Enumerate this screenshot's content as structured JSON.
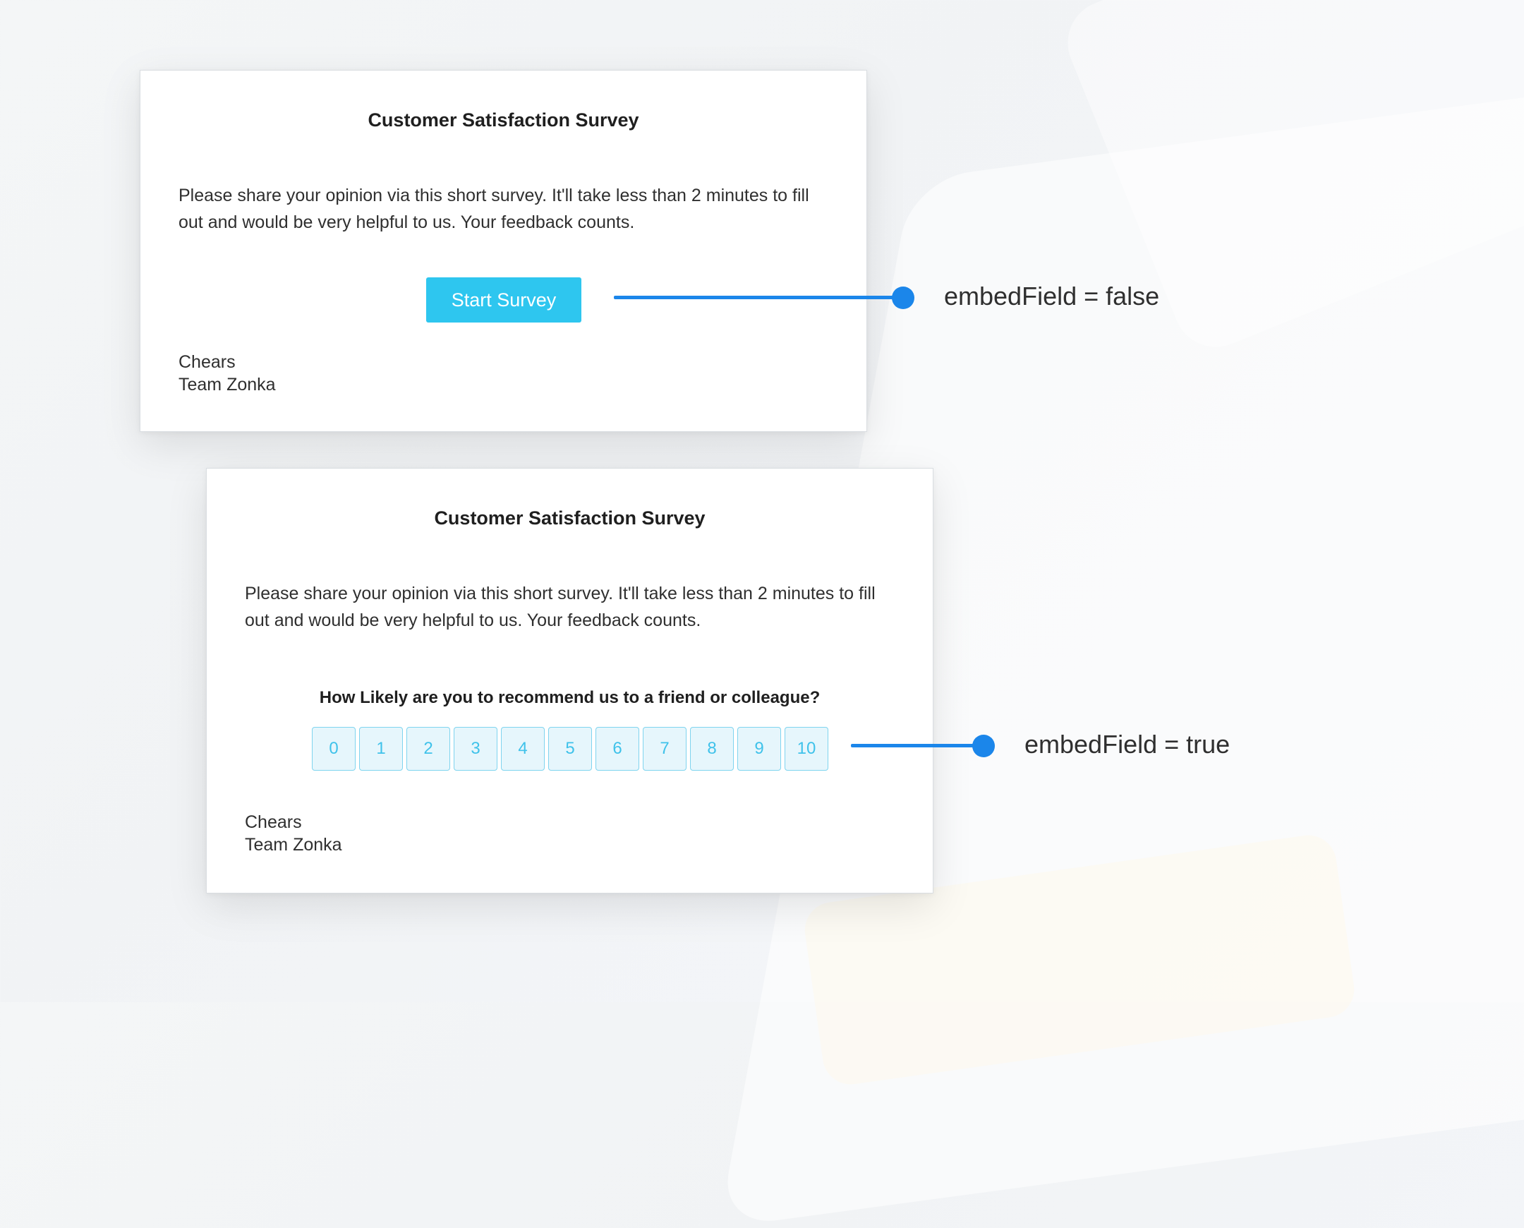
{
  "colors": {
    "accent": "#2ec6ef",
    "connector": "#1b86ea",
    "scale_fill": "#e6f6fc",
    "scale_border": "#7fd4ef",
    "scale_text": "#3fc2ea"
  },
  "cards": [
    {
      "title": "Customer Satisfaction Survey",
      "body": "Please share your opinion via this short survey. It'll take less than 2 minutes to fill out and would be very helpful to us. Your feedback counts.",
      "button_label": "Start Survey",
      "signoff_line1": "Chears",
      "signoff_line2": "Team Zonka"
    },
    {
      "title": "Customer Satisfaction Survey",
      "body": "Please share your opinion via this short survey. It'll take less than 2 minutes to fill out and would be very helpful to us. Your feedback counts.",
      "question": "How Likely are you to recommend us to a friend or colleague?",
      "scale": [
        "0",
        "1",
        "2",
        "3",
        "4",
        "5",
        "6",
        "7",
        "8",
        "9",
        "10"
      ],
      "signoff_line1": "Chears",
      "signoff_line2": "Team Zonka"
    }
  ],
  "annotations": [
    {
      "label": "embedField = false"
    },
    {
      "label": "embedField = true"
    }
  ]
}
